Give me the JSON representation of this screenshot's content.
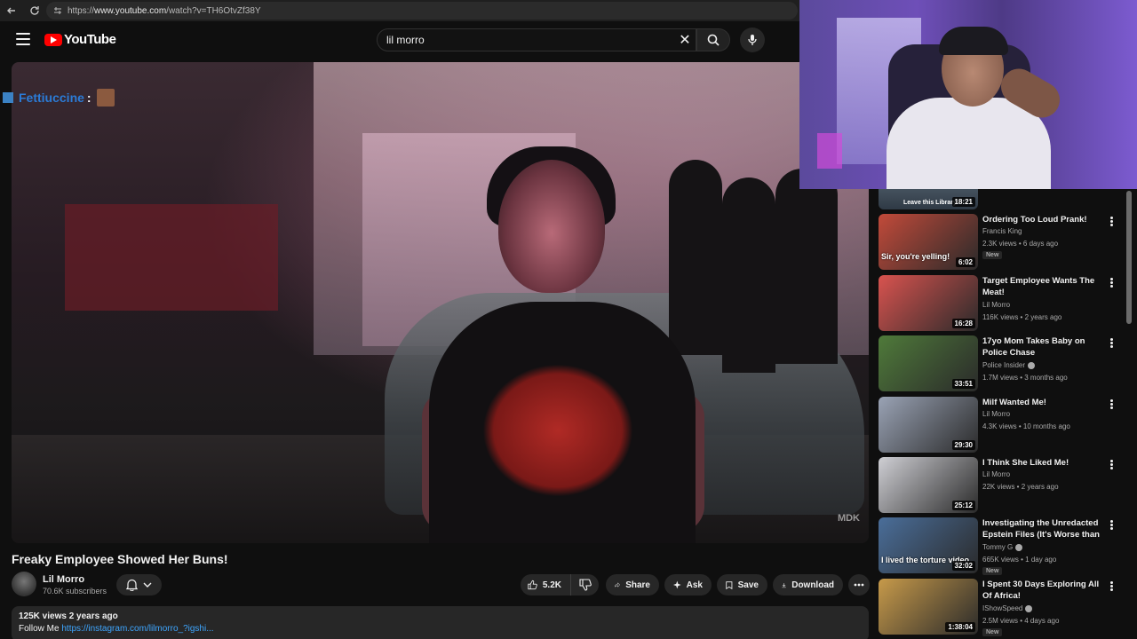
{
  "browser": {
    "url_prefix": "https://",
    "url_host": "www.youtube.com",
    "url_path": "/watch?v=TH6OtvZf38Y"
  },
  "header": {
    "logo_text": "YouTube",
    "search_value": "lil morro"
  },
  "overlay": {
    "chat_user": "Fettiuccine",
    "chat_colon": ":",
    "watermark": "MDK"
  },
  "video": {
    "title": "Freaky Employee Showed Her Buns!",
    "channel": "Lil Morro",
    "subscribers": "70.6K subscribers",
    "likes": "5.2K",
    "share_label": "Share",
    "ask_label": "Ask",
    "save_label": "Save",
    "download_label": "Download",
    "views_date": "125K views  2 years ago",
    "follow_label": "Follow Me",
    "follow_link": "https://instagram.com/lilmorro_?igshi..."
  },
  "recs": {
    "partial_duration": "18:21",
    "partial_thumb_text": "Leave this Library!",
    "items": [
      {
        "title": "Ordering Too Loud Prank!",
        "channel": "Francis King",
        "meta": "2.3K views • 6 days ago",
        "duration": "6:02",
        "badge": "New",
        "thumb_text": "Sir, you're yelling!",
        "color": "#c24a3a"
      },
      {
        "title": "Target Employee Wants The Meat!",
        "channel": "Lil Morro",
        "meta": "116K views • 2 years ago",
        "duration": "16:28",
        "badge": "",
        "thumb_text": "",
        "color": "#d9534f"
      },
      {
        "title": "17yo Mom Takes Baby on Police Chase",
        "channel": "Police Insider",
        "meta": "1.7M views • 3 months ago",
        "duration": "33:51",
        "badge": "",
        "thumb_text": "",
        "color": "#4f7a3a",
        "verified": true
      },
      {
        "title": "Milf Wanted Me!",
        "channel": "Lil Morro",
        "meta": "4.3K views • 10 months ago",
        "duration": "29:30",
        "badge": "",
        "thumb_text": "",
        "color": "#9aa3b5"
      },
      {
        "title": "I Think She Liked Me!",
        "channel": "Lil Morro",
        "meta": "22K views • 2 years ago",
        "duration": "25:12",
        "badge": "",
        "thumb_text": "",
        "color": "#cfcfd4"
      },
      {
        "title": "Investigating the Unredacted Epstein Files (It's Worse than ...",
        "channel": "Tommy G",
        "meta": "665K views • 1 day ago",
        "duration": "32:02",
        "badge": "New",
        "thumb_text": "I lived the torture video",
        "color": "#4a6e9a",
        "verified": true
      },
      {
        "title": "I Spent 30 Days Exploring All Of Africa!",
        "channel": "IShowSpeed",
        "meta": "2.5M views • 4 days ago",
        "duration": "1:38:04",
        "badge": "New",
        "thumb_text": "",
        "color": "#c79a4a",
        "verified": true
      }
    ]
  },
  "colors": {
    "accent_red": "#ff0000",
    "link_blue": "#3ea6ff",
    "chat_blue": "#2b7bd6"
  }
}
